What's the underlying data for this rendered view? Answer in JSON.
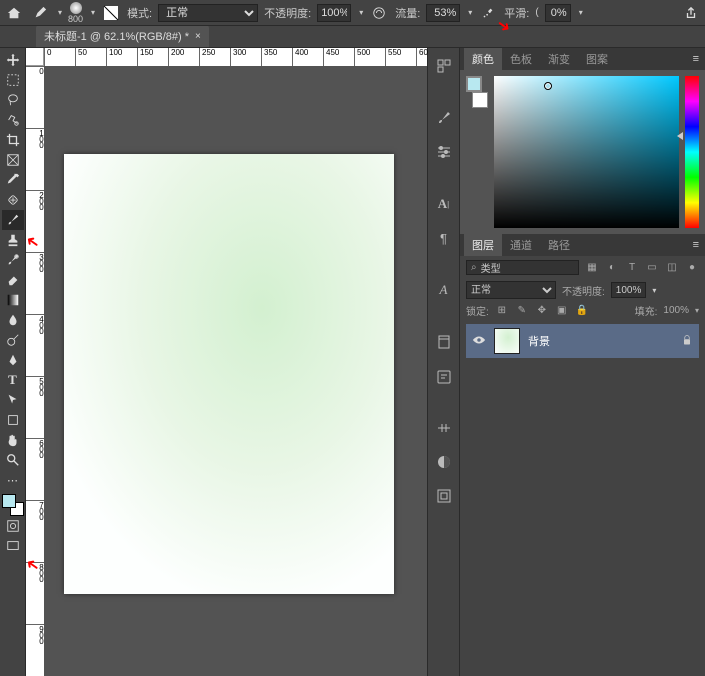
{
  "topbar": {
    "brush_size": "800",
    "mode_label": "模式:",
    "mode_value": "正常",
    "opacity_label": "不透明度:",
    "opacity_value": "100%",
    "flow_label": "流量:",
    "flow_value": "53%",
    "smoothing_label": "平滑:",
    "smoothing_value": "0%"
  },
  "document": {
    "tab_title": "未标题-1 @ 62.1%(RGB/8#) *"
  },
  "ruler_h": [
    "0",
    "50",
    "100",
    "150",
    "200",
    "250",
    "300",
    "350",
    "400",
    "450",
    "500",
    "550",
    "60"
  ],
  "ruler_v": [
    "0",
    "100",
    "200",
    "300",
    "400",
    "500",
    "600",
    "700",
    "800",
    "900"
  ],
  "panels": {
    "color": {
      "tabs": [
        "颜色",
        "色板",
        "渐变",
        "图案"
      ]
    },
    "layers": {
      "tabs": [
        "图层",
        "通道",
        "路径"
      ],
      "filter_label": "类型",
      "blend_mode": "正常",
      "opacity_label": "不透明度:",
      "opacity_value": "100%",
      "lock_label": "锁定:",
      "fill_label": "填充:",
      "fill_value": "100%",
      "items": [
        {
          "name": "背景"
        }
      ]
    }
  },
  "colors": {
    "foreground": "#b8e8f0",
    "background": "#ffffff"
  }
}
